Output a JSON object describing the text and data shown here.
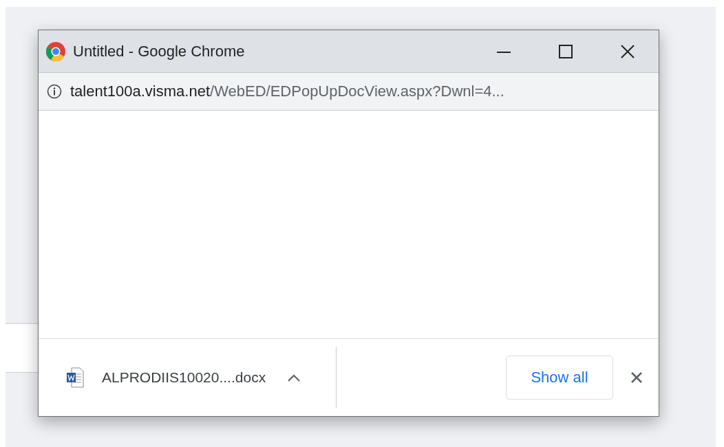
{
  "window": {
    "title": "Untitled - Google Chrome"
  },
  "address_bar": {
    "host": "talent100a.visma.net",
    "path": "/WebED/EDPopUpDocView.aspx?Dwnl=4..."
  },
  "download_bar": {
    "items": [
      {
        "filename": "ALPRODIIS10020....docx"
      }
    ],
    "show_all_button": "Show all"
  }
}
